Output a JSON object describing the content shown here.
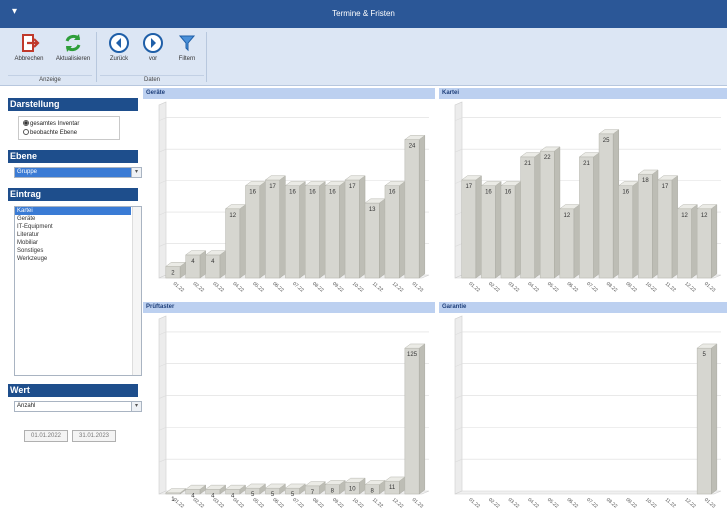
{
  "window": {
    "title": "Termine & Fristen",
    "menu_icon": "menu-arrow-icon"
  },
  "ribbon": {
    "groups": [
      {
        "label": "Anzeige",
        "buttons": [
          {
            "label": "Abbrechen",
            "icon": "exit-icon"
          },
          {
            "label": "Aktualisieren",
            "icon": "refresh-icon"
          }
        ]
      },
      {
        "label": "Daten",
        "buttons": [
          {
            "label": "Zurück",
            "icon": "back-icon"
          },
          {
            "label": "vor",
            "icon": "forward-icon"
          },
          {
            "label": "Filtern",
            "icon": "filter-icon"
          }
        ]
      }
    ]
  },
  "sidebar": {
    "darstellung": {
      "header": "Darstellung",
      "options": [
        {
          "label": "gesamtes Inventar",
          "selected": true
        },
        {
          "label": "beobachte Ebene",
          "selected": false
        }
      ]
    },
    "ebene": {
      "header": "Ebene",
      "value": "Gruppe"
    },
    "eintrag": {
      "header": "Eintrag",
      "items": [
        "Kartei",
        "Geräte",
        "IT-Equipment",
        "Literatur",
        "Mobiliar",
        "Sonstiges",
        "Werkzeuge"
      ],
      "selected_index": 0
    },
    "wert": {
      "header": "Wert",
      "value": "Anzahl"
    },
    "dates": [
      "01.01.2022",
      "31.01.2023"
    ]
  },
  "chart_data": [
    {
      "type": "bar",
      "title": "Geräte",
      "categories": [
        "01.22",
        "02.22",
        "03.22",
        "04.22",
        "05.22",
        "06.22",
        "07.22",
        "08.22",
        "09.22",
        "10.22",
        "11.22",
        "12.22",
        "01.23"
      ],
      "values": [
        2,
        4,
        4,
        12,
        16,
        17,
        16,
        16,
        16,
        17,
        13,
        16,
        24
      ],
      "value_labels": [
        "2",
        "4",
        "4",
        "12",
        "16",
        "17",
        "16",
        "16",
        "16",
        "17",
        "13",
        "16",
        "24"
      ],
      "ylim": [
        0,
        30
      ]
    },
    {
      "type": "bar",
      "title": "Kartei",
      "categories": [
        "01.22",
        "02.22",
        "03.22",
        "04.22",
        "05.22",
        "06.22",
        "07.22",
        "08.22",
        "09.22",
        "10.22",
        "11.22",
        "12.22",
        "01.23"
      ],
      "values": [
        17,
        16,
        16,
        21,
        22,
        12,
        21,
        25,
        16,
        18,
        17,
        12,
        12
      ],
      "value_labels": [
        "17",
        "16",
        "16",
        "21",
        "22",
        "12",
        "21",
        "25",
        "16",
        "18",
        "17",
        "12",
        "12"
      ],
      "ylim": [
        0,
        30
      ]
    },
    {
      "type": "bar",
      "title": "Prüftaster",
      "categories": [
        "01.22",
        "02.22",
        "03.22",
        "04.22",
        "05.22",
        "06.22",
        "07.22",
        "08.22",
        "09.22",
        "10.22",
        "11.22",
        "12.22",
        "01.23"
      ],
      "values": [
        1,
        4,
        4,
        4,
        5,
        5,
        5,
        7,
        8,
        10,
        8,
        11,
        125
      ],
      "value_labels": [
        "1",
        "4",
        "4",
        "4",
        "5",
        "5",
        "5",
        "7",
        "8",
        "10",
        "8",
        "11",
        "125"
      ],
      "ylim": [
        0,
        150
      ]
    },
    {
      "type": "bar",
      "title": "Garantie",
      "categories": [
        "01.22",
        "02.22",
        "03.22",
        "04.22",
        "05.22",
        "06.22",
        "07.22",
        "08.22",
        "09.22",
        "10.22",
        "11.22",
        "12.22",
        "01.23"
      ],
      "values": [
        0,
        0,
        0,
        0,
        0,
        0,
        0,
        0,
        0,
        0,
        0,
        0,
        5
      ],
      "value_labels": [
        "",
        "",
        "",
        "",
        "",
        "",
        "",
        "",
        "",
        "",
        "",
        "",
        "5"
      ],
      "ylim": [
        0,
        6
      ]
    }
  ]
}
